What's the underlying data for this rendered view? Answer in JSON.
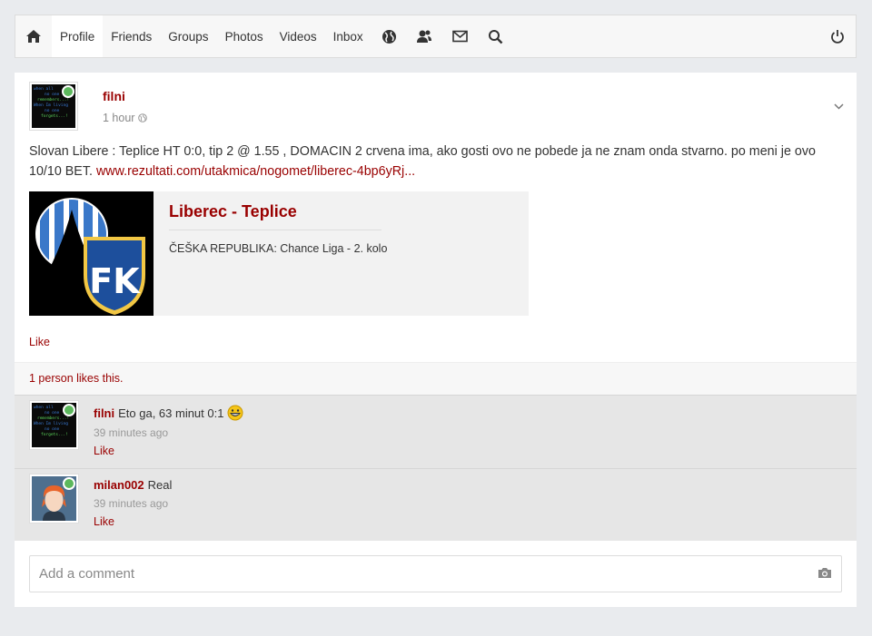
{
  "nav": {
    "items": [
      {
        "label": "Profile",
        "active": true
      },
      {
        "label": "Friends"
      },
      {
        "label": "Groups"
      },
      {
        "label": "Photos"
      },
      {
        "label": "Videos"
      },
      {
        "label": "Inbox"
      }
    ],
    "icons": [
      "home-icon",
      "globe-icon",
      "friend-requests-icon",
      "mail-icon",
      "search-icon",
      "power-icon"
    ]
  },
  "post": {
    "author": "filni",
    "time": "1 hour",
    "text": "Slovan Libere : Teplice HT 0:0, tip 2 @ 1.55 , DOMACIN 2 crvena ima, ako gosti ovo ne pobede ja ne znam onda stvarno. po meni je ovo 10/10 BET.",
    "link_text": "www.rezultati.com/utakmica/nogomet/liberec-4bp6yRj...",
    "link_preview": {
      "title": "Liberec - Teplice",
      "description": "ČEŠKA REPUBLIKA: Chance Liga - 2. kolo",
      "logo_text": "FK"
    },
    "like_label": "Like",
    "likes_text": "1 person likes this."
  },
  "comments": [
    {
      "author": "filni",
      "text": "Eto ga, 63 minut 0:1",
      "emoji": "grinning-emoji",
      "time": "39 minutes ago",
      "like_label": "Like"
    },
    {
      "author": "milan002",
      "text": "Real",
      "time": "39 minutes ago",
      "like_label": "Like"
    }
  ],
  "add_comment": {
    "placeholder": "Add a comment"
  },
  "avatar_code": {
    "l1": "when all",
    "l2": "no one",
    "l3": "remembers...!",
    "l4": "When Im living",
    "l5": "no one",
    "l6": "forgets...!"
  },
  "colors": {
    "accent": "#990000",
    "online": "#5cb85c",
    "background": "#e9ebee"
  }
}
